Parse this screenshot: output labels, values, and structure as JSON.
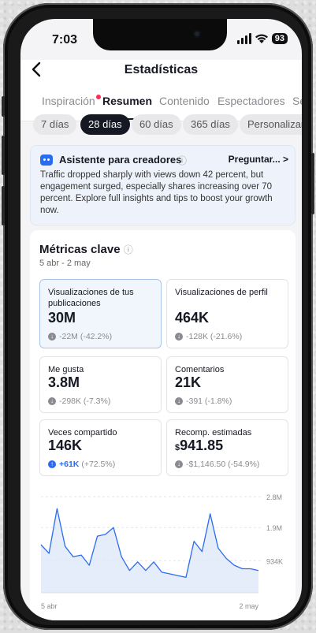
{
  "status_bar": {
    "time": "7:03",
    "battery": "93"
  },
  "header": {
    "title": "Estadísticas",
    "back_icon": "chevron-left-icon"
  },
  "tabs": [
    {
      "label": "Inspiración",
      "has_dot": true
    },
    {
      "label": "Resumen",
      "active": true
    },
    {
      "label": "Contenido"
    },
    {
      "label": "Espectadores"
    },
    {
      "label": "Se"
    }
  ],
  "periods": [
    {
      "label": "7 días"
    },
    {
      "label": "28 días",
      "active": true
    },
    {
      "label": "60 días"
    },
    {
      "label": "365 días"
    },
    {
      "label": "Personalizar"
    }
  ],
  "assistant": {
    "title": "Asistente para creadores",
    "link": "Preguntar... >",
    "body": "Traffic dropped sharply with views down 42 percent, but engagement surged, especially shares increasing over 70 percent. Explore full insights and tips to boost your growth now."
  },
  "metrics_section": {
    "title": "Métricas clave",
    "date_range": "5 abr - 2 may",
    "metrics": [
      {
        "label": "Visualizaciones de tus publicaciones",
        "value": "30M",
        "delta": "-22M (-42.2%)",
        "direction": "down",
        "selected": true
      },
      {
        "label": "Visualizaciones de perfil",
        "value": "464K",
        "delta": "-128K (-21.6%)",
        "direction": "down"
      },
      {
        "label": "Me gusta",
        "value": "3.8M",
        "delta": "-298K (-7.3%)",
        "direction": "down"
      },
      {
        "label": "Comentarios",
        "value": "21K",
        "delta": "-391 (-1.8%)",
        "direction": "down"
      },
      {
        "label": "Veces compartido",
        "value": "146K",
        "delta_strong": "+61K",
        "delta_rest": " (+72.5%)",
        "direction": "up"
      },
      {
        "label": "Recomp. estimadas",
        "currency": "$",
        "value": "941.85",
        "delta": "-$1,146.50 (-54.9%)",
        "direction": "down"
      }
    ]
  },
  "chart_data": {
    "type": "area",
    "y_tick_labels": [
      "2.8M",
      "1.9M",
      "934K"
    ],
    "y_ticks": [
      2800000,
      1900000,
      934000
    ],
    "ylim": [
      0,
      2800000
    ],
    "x_tick_labels": [
      "5 abr",
      "2 may"
    ],
    "x": [
      "5 abr",
      "6 abr",
      "7 abr",
      "8 abr",
      "9 abr",
      "10 abr",
      "11 abr",
      "12 abr",
      "13 abr",
      "14 abr",
      "15 abr",
      "16 abr",
      "17 abr",
      "18 abr",
      "19 abr",
      "20 abr",
      "21 abr",
      "22 abr",
      "23 abr",
      "24 abr",
      "25 abr",
      "26 abr",
      "27 abr",
      "28 abr",
      "29 abr",
      "30 abr",
      "1 may",
      "2 may"
    ],
    "values": [
      1400000,
      1150000,
      2450000,
      1350000,
      1050000,
      1100000,
      800000,
      1650000,
      1700000,
      1900000,
      1050000,
      650000,
      900000,
      650000,
      900000,
      600000,
      550000,
      500000,
      450000,
      1500000,
      1200000,
      2300000,
      1300000,
      1000000,
      800000,
      700000,
      700000,
      650000
    ],
    "color": "#2a6cf0",
    "fill": "#dde8f8",
    "grid": true
  }
}
